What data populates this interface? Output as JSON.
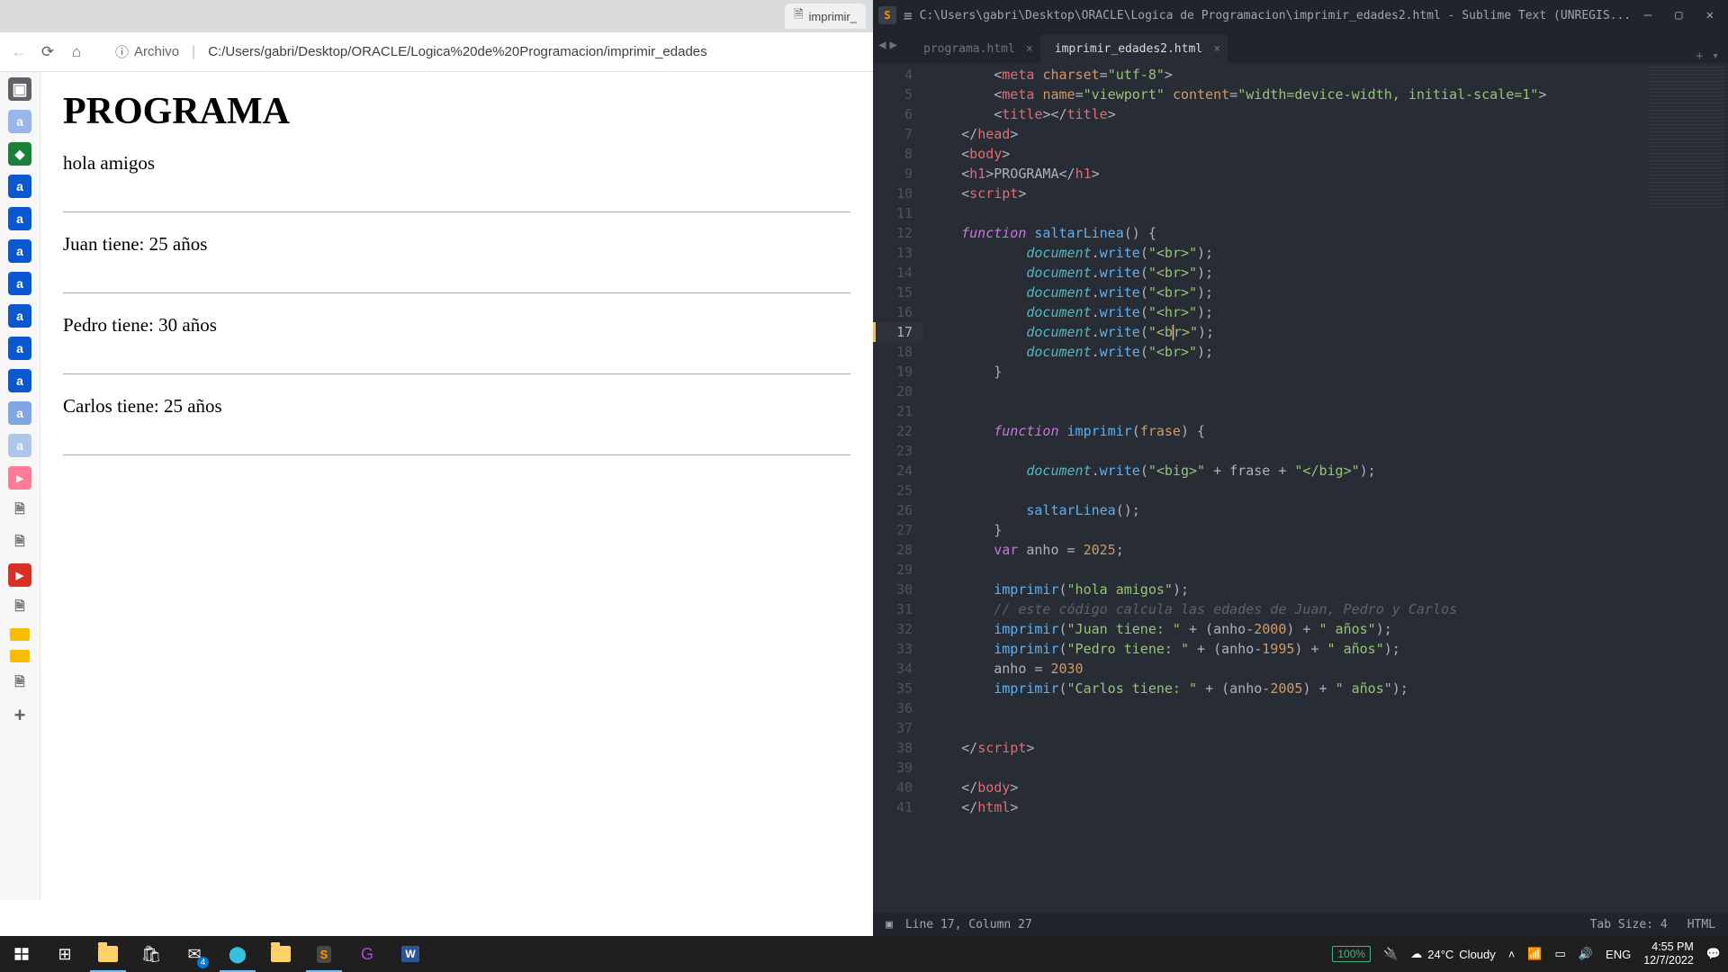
{
  "browser": {
    "tab_title": "imprimir_",
    "url_scheme": "Archivo",
    "url_path": "C:/Users/gabri/Desktop/ORACLE/Logica%20de%20Programacion/imprimir_edades",
    "page": {
      "heading": "PROGRAMA",
      "lines": [
        "hola amigos",
        "Juan tiene: 25 años",
        "Pedro tiene: 30 años",
        "Carlos tiene: 25 años"
      ]
    }
  },
  "sublime": {
    "title": "C:\\Users\\gabri\\Desktop\\ORACLE\\Logica de Programacion\\imprimir_edades2.html - Sublime Text (UNREGIS...",
    "tabs": [
      {
        "name": "programa.html",
        "active": false
      },
      {
        "name": "imprimir_edades2.html",
        "active": true
      }
    ],
    "first_line": 4,
    "code_lines": [
      {
        "n": 4,
        "html": "        <span class='pun'>&lt;</span><span class='tag-red'>meta</span> <span class='attr-orange'>charset</span><span class='pun'>=</span><span class='str'>\"utf-8\"</span><span class='pun'>&gt;</span>"
      },
      {
        "n": 5,
        "html": "        <span class='pun'>&lt;</span><span class='tag-red'>meta</span> <span class='attr-orange'>name</span><span class='pun'>=</span><span class='str'>\"viewport\"</span> <span class='attr-orange'>content</span><span class='pun'>=</span><span class='str'>\"width=device-width, initial-scale=1\"</span><span class='pun'>&gt;</span>"
      },
      {
        "n": 6,
        "html": "        <span class='pun'>&lt;</span><span class='tag-red'>title</span><span class='pun'>&gt;&lt;/</span><span class='tag-red'>title</span><span class='pun'>&gt;</span>"
      },
      {
        "n": 7,
        "html": "    <span class='pun'>&lt;/</span><span class='tag-red'>head</span><span class='pun'>&gt;</span>"
      },
      {
        "n": 8,
        "html": "    <span class='pun'>&lt;</span><span class='tag-red'>body</span><span class='pun'>&gt;</span>"
      },
      {
        "n": 9,
        "html": "    <span class='pun'>&lt;</span><span class='tag-red'>h1</span><span class='pun'>&gt;</span><span class='pun'>PROGRAMA</span><span class='pun'>&lt;/</span><span class='tag-red'>h1</span><span class='pun'>&gt;</span>"
      },
      {
        "n": 10,
        "html": "    <span class='pun'>&lt;</span><span class='tag-red'>script</span><span class='pun'>&gt;</span>"
      },
      {
        "n": 11,
        "html": ""
      },
      {
        "n": 12,
        "html": "    <span class='kw'>function</span> <span class='fn-blue'>saltarLinea</span><span class='pun'>() {</span>"
      },
      {
        "n": 13,
        "html": "            <span class='var-teal'>document</span><span class='pun'>.</span><span class='fn-blue'>write</span><span class='pun'>(</span><span class='str'>\"&lt;br&gt;\"</span><span class='pun'>);</span>"
      },
      {
        "n": 14,
        "html": "            <span class='var-teal'>document</span><span class='pun'>.</span><span class='fn-blue'>write</span><span class='pun'>(</span><span class='str'>\"&lt;br&gt;\"</span><span class='pun'>);</span>"
      },
      {
        "n": 15,
        "html": "            <span class='var-teal'>document</span><span class='pun'>.</span><span class='fn-blue'>write</span><span class='pun'>(</span><span class='str'>\"&lt;br&gt;\"</span><span class='pun'>);</span>"
      },
      {
        "n": 16,
        "html": "            <span class='var-teal'>document</span><span class='pun'>.</span><span class='fn-blue'>write</span><span class='pun'>(</span><span class='str'>\"&lt;hr&gt;\"</span><span class='pun'>);</span>"
      },
      {
        "n": 17,
        "html": "            <span class='var-teal'>document</span><span class='pun'>.</span><span class='fn-blue'>write</span><span class='pun'>(</span><span class='str'>\"&lt;b</span><span class='cursor'></span><span class='str'>r&gt;\"</span><span class='pun'>);</span>",
        "current": true
      },
      {
        "n": 18,
        "html": "            <span class='var-teal'>document</span><span class='pun'>.</span><span class='fn-blue'>write</span><span class='pun'>(</span><span class='str'>\"&lt;br&gt;\"</span><span class='pun'>);</span>"
      },
      {
        "n": 19,
        "html": "        <span class='pun'>}</span>"
      },
      {
        "n": 20,
        "html": ""
      },
      {
        "n": 21,
        "html": ""
      },
      {
        "n": 22,
        "html": "        <span class='kw'>function</span> <span class='fn-blue'>imprimir</span><span class='pun'>(</span><span class='attr-orange'>frase</span><span class='pun'>) {</span>"
      },
      {
        "n": 23,
        "html": ""
      },
      {
        "n": 24,
        "html": "            <span class='var-teal'>document</span><span class='pun'>.</span><span class='fn-blue'>write</span><span class='pun'>(</span><span class='str'>\"&lt;big&gt;\"</span> <span class='pun'>+</span> <span class='pun'>frase</span> <span class='pun'>+</span> <span class='str'>\"&lt;/big&gt;\"</span><span class='pun'>);</span>"
      },
      {
        "n": 25,
        "html": ""
      },
      {
        "n": 26,
        "html": "            <span class='fn-blue'>saltarLinea</span><span class='pun'>();</span>"
      },
      {
        "n": 27,
        "html": "        <span class='pun'>}</span>"
      },
      {
        "n": 28,
        "html": "        <span class='kw2'>var</span> <span class='pun'>anho</span> <span class='pun'>=</span> <span class='num'>2025</span><span class='pun'>;</span>"
      },
      {
        "n": 29,
        "html": ""
      },
      {
        "n": 30,
        "html": "        <span class='fn-blue'>imprimir</span><span class='pun'>(</span><span class='str'>\"hola amigos\"</span><span class='pun'>);</span>"
      },
      {
        "n": 31,
        "html": "        <span class='cmt'>// este código calcula las edades de Juan, Pedro y Carlos</span>"
      },
      {
        "n": 32,
        "html": "        <span class='fn-blue'>imprimir</span><span class='pun'>(</span><span class='str'>\"Juan tiene: \"</span> <span class='pun'>+ (anho-</span><span class='num'>2000</span><span class='pun'>) +</span> <span class='str'>\" años\"</span><span class='pun'>);</span>"
      },
      {
        "n": 33,
        "html": "        <span class='fn-blue'>imprimir</span><span class='pun'>(</span><span class='str'>\"Pedro tiene: \"</span> <span class='pun'>+ (anho-</span><span class='num'>1995</span><span class='pun'>) +</span> <span class='str'>\" años\"</span><span class='pun'>);</span>"
      },
      {
        "n": 34,
        "html": "        <span class='pun'>anho =</span> <span class='num'>2030</span>"
      },
      {
        "n": 35,
        "html": "        <span class='fn-blue'>imprimir</span><span class='pun'>(</span><span class='str'>\"Carlos tiene: \"</span> <span class='pun'>+ (anho-</span><span class='num'>2005</span><span class='pun'>) +</span> <span class='str'>\" años\"</span><span class='pun'>);</span>"
      },
      {
        "n": 36,
        "html": ""
      },
      {
        "n": 37,
        "html": ""
      },
      {
        "n": 38,
        "html": "    <span class='pun'>&lt;/</span><span class='tag-red'>script</span><span class='pun'>&gt;</span>"
      },
      {
        "n": 39,
        "html": ""
      },
      {
        "n": 40,
        "html": "    <span class='pun'>&lt;/</span><span class='tag-red'>body</span><span class='pun'>&gt;</span>"
      },
      {
        "n": 41,
        "html": "    <span class='pun'>&lt;/</span><span class='tag-red'>html</span><span class='pun'>&gt;</span>"
      }
    ],
    "status": {
      "cursor": "Line 17, Column 27",
      "tab_size": "Tab Size: 4",
      "syntax": "HTML"
    }
  },
  "taskbar": {
    "battery": "100%",
    "weather_temp": "24°C",
    "weather_text": "Cloudy",
    "lang": "ENG",
    "time": "4:55 PM",
    "date": "12/7/2022"
  }
}
